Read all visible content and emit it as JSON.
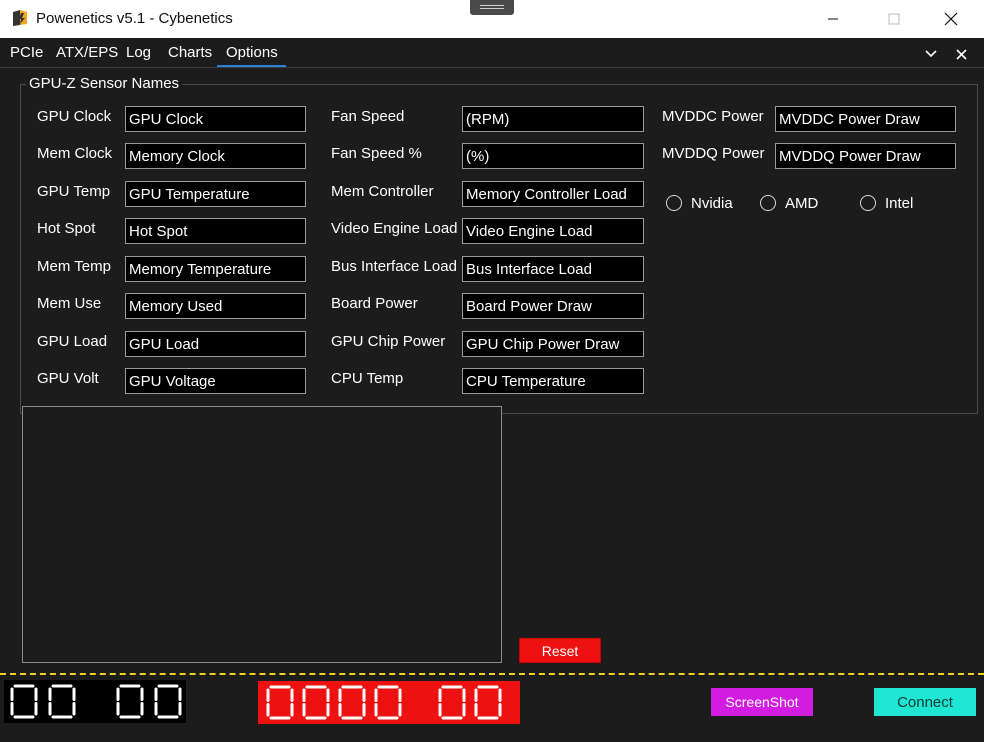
{
  "window": {
    "title": "Powenetics v5.1 - Cybenetics"
  },
  "tabs": [
    {
      "label": "PCIe"
    },
    {
      "label": "ATX/EPS"
    },
    {
      "label": "Log"
    },
    {
      "label": "Charts"
    },
    {
      "label": "Options",
      "active": true
    }
  ],
  "group": {
    "title": "GPU-Z Sensor Names"
  },
  "col1": [
    {
      "label": "GPU Clock",
      "value": "GPU Clock"
    },
    {
      "label": "Mem Clock",
      "value": "Memory Clock"
    },
    {
      "label": "GPU Temp",
      "value": "GPU Temperature"
    },
    {
      "label": "Hot Spot",
      "value": "Hot Spot"
    },
    {
      "label": "Mem Temp",
      "value": "Memory Temperature"
    },
    {
      "label": "Mem Use",
      "value": "Memory Used"
    },
    {
      "label": "GPU Load",
      "value": "GPU Load"
    },
    {
      "label": "GPU Volt",
      "value": "GPU Voltage"
    }
  ],
  "col2": [
    {
      "label": "Fan Speed",
      "value": "(RPM)"
    },
    {
      "label": "Fan Speed %",
      "value": "(%)"
    },
    {
      "label": "Mem Controller",
      "value": "Memory Controller Load"
    },
    {
      "label": "Video Engine Load",
      "value": "Video Engine Load"
    },
    {
      "label": "Bus Interface Load",
      "value": "Bus Interface Load"
    },
    {
      "label": "Board Power",
      "value": "Board Power Draw"
    },
    {
      "label": "GPU Chip Power",
      "value": "GPU Chip Power Draw"
    },
    {
      "label": "CPU Temp",
      "value": "CPU Temperature"
    }
  ],
  "col3": [
    {
      "label": "MVDDC Power",
      "value": "MVDDC Power Draw"
    },
    {
      "label": "MVDDQ Power",
      "value": "MVDDQ Power Draw"
    }
  ],
  "vendor": {
    "options": [
      "Nvidia",
      "AMD",
      "Intel"
    ],
    "selected": null
  },
  "buttons": {
    "reset": "Reset",
    "screenshot": "ScreenShot",
    "connect": "Connect"
  },
  "displays": {
    "time": "00 00",
    "counter": "0000 00"
  },
  "colors": {
    "tab_accent": "#2f7fd6",
    "reset_bg": "#ee1111",
    "screenshot_bg": "#d21de0",
    "connect_bg": "#1ee6d2",
    "status_line": "#f2d21a",
    "counter_bg": "#ee1111"
  },
  "icons": {
    "app": "powenetics-logo-icon",
    "minimize": "minimize-icon",
    "maximize": "maximize-icon",
    "close": "close-icon",
    "tab_dropdown": "chevron-down-icon",
    "tab_close": "close-icon"
  }
}
